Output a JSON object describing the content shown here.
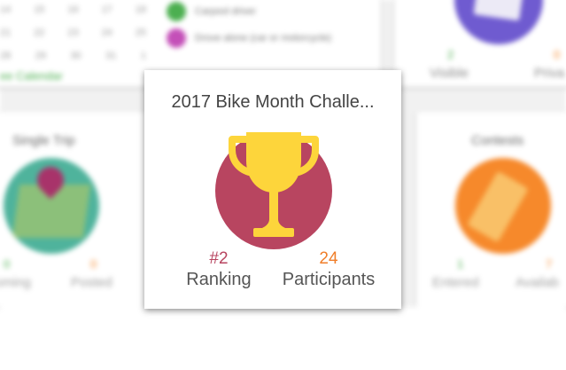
{
  "background": {
    "calendar": {
      "rows": [
        [
          "14",
          "15",
          "16",
          "17",
          "18"
        ],
        [
          "21",
          "22",
          "23",
          "24",
          "25"
        ],
        [
          "28",
          "29",
          "30",
          "31",
          "1"
        ]
      ],
      "link_label": "ee Calendar"
    },
    "legend": [
      {
        "label": "Carpool driver",
        "color": "#4caf50"
      },
      {
        "label": "Drove alone (car or motorcycle)",
        "color": "#c44fb8"
      }
    ],
    "visibility": {
      "visible_count": "2",
      "visible_label": "Visible",
      "private_count": "0",
      "private_label": "Priva",
      "visible_color": "#4caf50",
      "private_color": "#f6892b"
    },
    "single_trip": {
      "title": "Single Trip",
      "left_count": "0",
      "left_label": "oming",
      "right_count": "0",
      "right_label": "Posted"
    },
    "contests": {
      "title": "Contests",
      "left_count": "1",
      "left_label": "Entered",
      "right_count": "7",
      "right_label": "Availab"
    }
  },
  "card": {
    "title": "2017 Bike Month Challe...",
    "icon": "trophy-icon",
    "circle_color": "#b84560",
    "trophy_color": "#fdd53b",
    "ranking": {
      "value": "#2",
      "label": "Ranking",
      "color": "#b84560"
    },
    "participants": {
      "value": "24",
      "label": "Participants",
      "color": "#f07e2a"
    }
  }
}
